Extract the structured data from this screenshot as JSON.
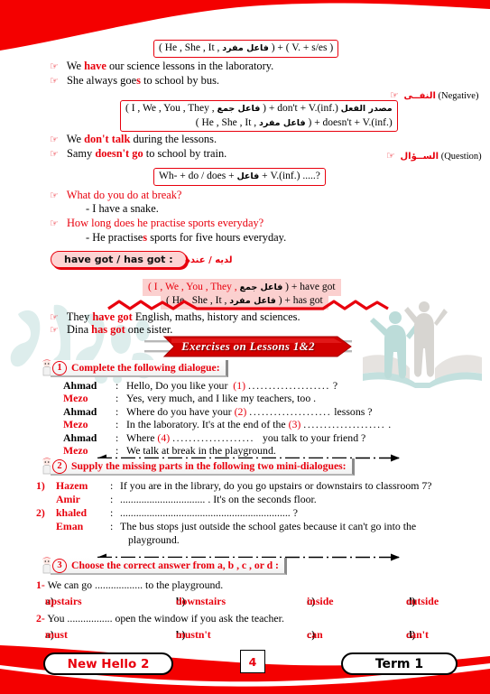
{
  "page": {
    "number": "4",
    "book_label": "New Hello 2",
    "term_label": "Term 1"
  },
  "grammar": {
    "affirmative_box": {
      "left": "( He , She , It ,",
      "arabic": "فاعل مفرد",
      "right": ") + ( V. + s/es )"
    },
    "affirmative_examples": [
      "We have our science lessons in the laboratory.",
      "She always goes to school by bus."
    ],
    "negative_tag": {
      "arabic": "النفــى",
      "english": "(Negative)"
    },
    "negative_box": {
      "line1_left": "( I , We , You , They ,",
      "line1_arabic": "فاعل جمع",
      "line1_right": ") + don't + V.(inf.)",
      "line1_note": "مصدر الفعل",
      "line2_left": "( He , She , It ,",
      "line2_arabic": "فاعل مفرد",
      "line2_right": ") + doesn't + V.(inf.)"
    },
    "negative_examples": [
      "We don't talk during the lessons.",
      "Samy doesn't go to school by train."
    ],
    "question_tag": {
      "arabic": "الســؤال",
      "english": "(Question)"
    },
    "question_box": {
      "left": "Wh- + do / does +",
      "arabic": "فاعل",
      "right": "+ V.(inf.) .....?"
    },
    "question_examples": [
      {
        "q": "What do you do at break?",
        "a": "- I have a snake."
      },
      {
        "q": "How long does he practise sports everyday?",
        "a": "- He practises sports for five hours everyday."
      }
    ],
    "havegot_chip": "have got / has got  :",
    "havegot_arabic": "لديه / عنده",
    "havegot_box": {
      "line1_left": "( I , We , You , They ,",
      "line1_arabic": "فاعل جمع",
      "line1_right": ") + have got",
      "line2_left": "( He , She , It ,",
      "line2_arabic": "فاعل مفرد",
      "line2_right": ") + has got"
    },
    "havegot_examples": [
      "They have got English, maths, history and sciences.",
      "Dina has got one sister."
    ]
  },
  "exercises": {
    "banner": "Exercises on Lessons 1&2",
    "q1": {
      "number": "1",
      "title": "Complete the following dialogue:",
      "lines": [
        {
          "name": "Ahmad",
          "name_color": "black",
          "text": "Hello, Do you like your  (1) ..................... ?"
        },
        {
          "name": "Mezo",
          "name_color": "red",
          "text": "Yes, very much, and I like my teachers, too ."
        },
        {
          "name": "Ahmad",
          "name_color": "black",
          "text": "Where do you have your (2) ..................... lessons ?"
        },
        {
          "name": "Mezo",
          "name_color": "red",
          "text": "In the laboratory. It's at the end of the (3) ..................... ."
        },
        {
          "name": "Ahmad",
          "name_color": "black",
          "text": "Where (4) .....................   you talk to your friend ?"
        },
        {
          "name": "Mezo",
          "name_color": "red",
          "text": "We talk at break in the playground."
        }
      ]
    },
    "q2": {
      "number": "2",
      "title": "Supply the missing parts in the following two mini-dialogues:",
      "items": [
        {
          "index": "1)",
          "rows": [
            {
              "name": "Hazem",
              "text": "If you are in the library, do you go upstairs or downstairs to classroom 7?"
            },
            {
              "name": "Amir",
              "text": "................................ . It's on the seconds floor."
            }
          ]
        },
        {
          "index": "2)",
          "rows": [
            {
              "name": "khaled",
              "text": "................................................................ ?"
            },
            {
              "name": "Eman",
              "text": "The bus stops just outside the school gates because it can't go into the"
            },
            {
              "name": "",
              "text": "playground."
            }
          ]
        }
      ]
    },
    "q3": {
      "number": "3",
      "title": "Choose the correct answer from a, b , c , or d :",
      "questions": [
        {
          "num": "1-",
          "stem": "We can go .................. to the playground.",
          "options": [
            {
              "letter": "a)",
              "value": "upstairs"
            },
            {
              "letter": "b)",
              "value": "downstairs"
            },
            {
              "letter": "c)",
              "value": "inside"
            },
            {
              "letter": "d)",
              "value": "outside"
            }
          ]
        },
        {
          "num": "2-",
          "stem": "You ................. open the window if you ask the teacher.",
          "options": [
            {
              "letter": "a)",
              "value": "must"
            },
            {
              "letter": "b)",
              "value": "mustn't"
            },
            {
              "letter": "c)",
              "value": "can"
            },
            {
              "letter": "d)",
              "value": "can't"
            }
          ]
        }
      ]
    }
  },
  "colors": {
    "brand_red": "#e8000d",
    "pink_fill": "#fbd0cf",
    "watermark_teal": "#8fc5c0"
  }
}
